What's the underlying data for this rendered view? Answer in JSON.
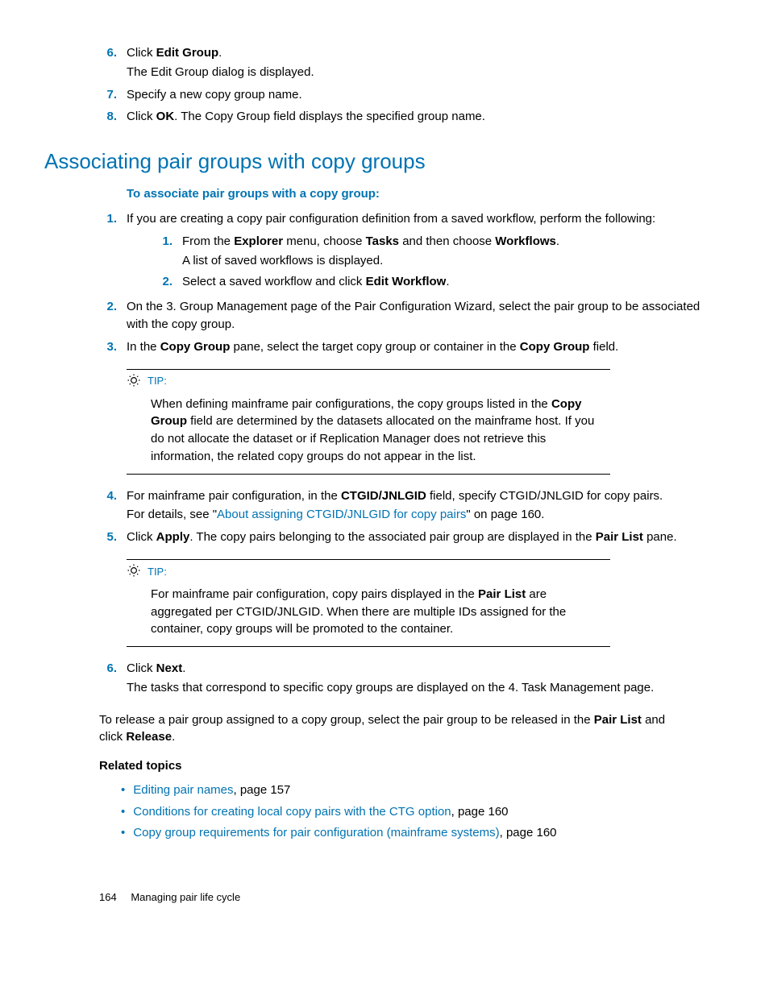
{
  "ol_top": {
    "six_num": "6.",
    "six_a": "Click ",
    "six_b": "Edit Group",
    "six_c": ".",
    "six_sub": "The Edit Group dialog is displayed.",
    "seven_num": "7.",
    "seven": "Specify a new copy group name.",
    "eight_num": "8.",
    "eight_a": "Click ",
    "eight_b": "OK",
    "eight_c": ". The Copy Group field displays the specified group name."
  },
  "section_title": "Associating pair groups with copy groups",
  "assoc_intro": "To associate pair groups with a copy group:",
  "assoc": {
    "one_num": "1.",
    "one": "If you are creating a copy pair configuration definition from a saved workflow, perform the following:",
    "one_a_num": "1.",
    "one_a_1": "From the ",
    "one_a_2": "Explorer",
    "one_a_3": " menu, choose ",
    "one_a_4": "Tasks",
    "one_a_5": " and then choose ",
    "one_a_6": "Workflows",
    "one_a_7": ".",
    "one_a_sub": "A list of saved workflows is displayed.",
    "one_b_num": "2.",
    "one_b_1": "Select a saved workflow and click ",
    "one_b_2": "Edit Workflow",
    "one_b_3": ".",
    "two_num": "2.",
    "two": "On the 3. Group Management page of the Pair Configuration Wizard, select the pair group to be associated with the copy group.",
    "three_num": "3.",
    "three_1": "In the ",
    "three_2": "Copy Group",
    "three_3": " pane, select the target copy group or container in the ",
    "three_4": "Copy Group",
    "three_5": " field.",
    "four_num": "4.",
    "four_1": "For mainframe pair configuration, in the ",
    "four_2": "CTGID/JNLGID",
    "four_3": " field, specify CTGID/JNLGID for copy pairs.",
    "four_sub_1": "For details, see \"",
    "four_sub_link": "About assigning CTGID/JNLGID for copy pairs",
    "four_sub_2": "\" on page 160.",
    "five_num": "5.",
    "five_1": "Click ",
    "five_2": "Apply",
    "five_3": ". The copy pairs belonging to the associated pair group are displayed in the ",
    "five_4": "Pair List",
    "five_5": " pane.",
    "six_num": "6.",
    "six_1": "Click ",
    "six_2": "Next",
    "six_3": ".",
    "six_sub": "The tasks that correspond to specific copy groups are displayed on the 4. Task Management page."
  },
  "tip1": {
    "label": "TIP:",
    "body_1": "When defining mainframe pair configurations, the copy groups listed in the ",
    "body_2": "Copy Group",
    "body_3": " field are determined by the datasets allocated on the mainframe host. If you do not allocate the dataset or if Replication Manager does not retrieve this information, the related copy groups do not appear in the list."
  },
  "tip2": {
    "label": "TIP:",
    "body_1": "For mainframe pair configuration, copy pairs displayed in the ",
    "body_2": "Pair List",
    "body_3": " are aggregated per CTGID/JNLGID. When there are multiple IDs assigned for the container, copy groups will be promoted to the container."
  },
  "release": {
    "t1": "To release a pair group assigned to a copy group, select the pair group to be released in the ",
    "t2": "Pair List",
    "t3": " and click ",
    "t4": "Release",
    "t5": "."
  },
  "related_head": "Related topics",
  "related": [
    {
      "link": "Editing pair names",
      "suffix": ", page 157"
    },
    {
      "link": "Conditions for creating local copy pairs with the CTG option",
      "suffix": ", page 160"
    },
    {
      "link": "Copy group requirements for pair configuration (mainframe systems)",
      "suffix": ", page 160"
    }
  ],
  "footer": {
    "page": "164",
    "title": "Managing pair life cycle"
  }
}
